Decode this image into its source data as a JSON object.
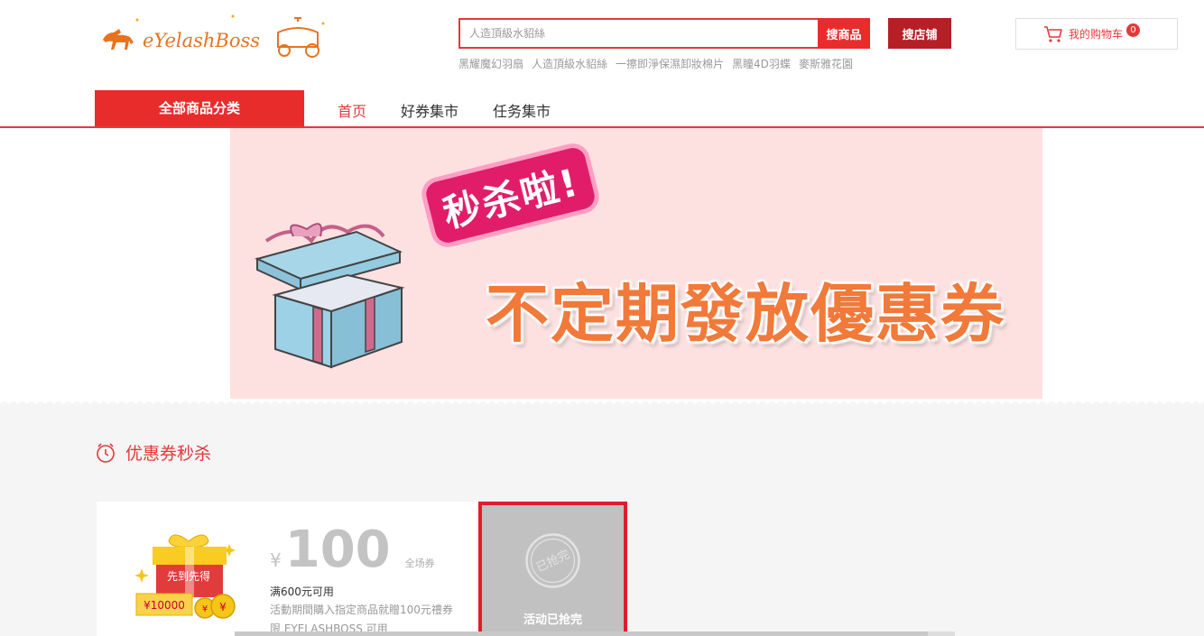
{
  "logo": {
    "text": "eyelashboss"
  },
  "search": {
    "placeholder": "人造頂級水貂絲",
    "goods_button": "搜商品",
    "shop_button": "搜店铺",
    "hot_words": [
      "黑耀魔幻羽扇",
      "人造頂級水貂絲",
      "一擦即淨保濕卸妝棉片",
      "黑瞳4D羽蝶",
      "麥斯雅花園"
    ]
  },
  "cart": {
    "label": "我的购物车",
    "count": "0",
    "icon": "cart-icon"
  },
  "nav": {
    "all_categories": "全部商品分类",
    "links": [
      "首页",
      "好券集市",
      "任务集市"
    ]
  },
  "banner": {
    "sticker": "秒杀啦!",
    "headline": "不定期發放優惠券"
  },
  "section": {
    "title": "优惠券秒杀",
    "icon": "clock-icon"
  },
  "coupon": {
    "gift_label": "先到先得",
    "gift_amount": "¥10000",
    "currency": "¥",
    "amount": "100",
    "scope": "全场券",
    "condition": "满600元可用",
    "description": "活動期間購入指定商品就贈100元禮券",
    "limit": "限 EYELASHBOSS 可用",
    "stamp": "已抢完",
    "status": "活动已抢完"
  },
  "colors": {
    "brand_red": "#e82c2c",
    "dark_red": "#b51f26",
    "banner_bg": "#fde1e1",
    "headline_orange": "#f1793a"
  }
}
